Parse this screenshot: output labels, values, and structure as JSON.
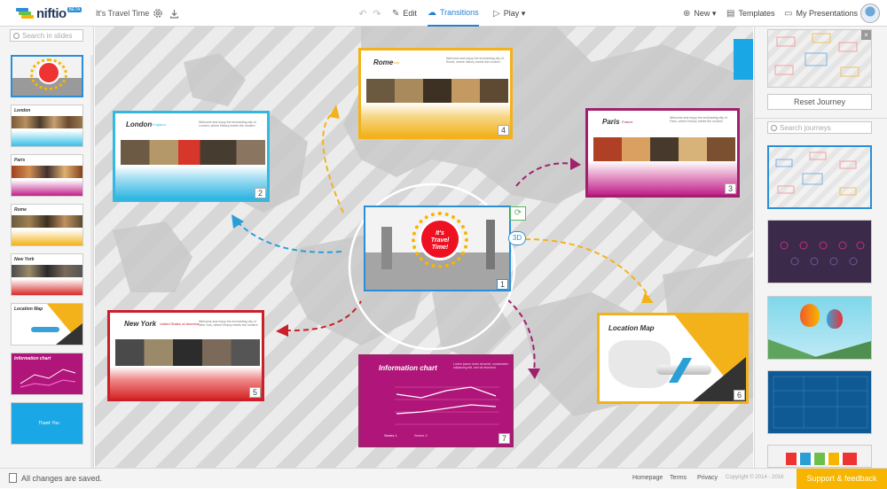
{
  "app": {
    "logo_text": "niftio",
    "logo_badge": "BETA",
    "doc_title": "It's Travel Time"
  },
  "toolbar": {
    "edit_label": "Edit",
    "transitions_label": "Transitions",
    "play_label": "Play ▾",
    "new_label": "New ▾",
    "templates_label": "Templates",
    "my_presentations_label": "My Presentations"
  },
  "left_panel": {
    "search_placeholder": "Search in slides",
    "thumbs": [
      {
        "title": "",
        "kind": "travel"
      },
      {
        "title": "London",
        "kind": "city",
        "sky": "#35c0e8"
      },
      {
        "title": "Paris",
        "kind": "city",
        "sky": "#c0208a"
      },
      {
        "title": "Rome",
        "kind": "city",
        "sky": "#f3b21a"
      },
      {
        "title": "New York",
        "kind": "city",
        "sky": "#d62828"
      },
      {
        "title": "Location Map",
        "kind": "map"
      },
      {
        "title": "Information chart",
        "kind": "chart"
      },
      {
        "title": "Thank You",
        "kind": "thanks"
      }
    ]
  },
  "canvas": {
    "slides": [
      {
        "num": "1",
        "title_lines": [
          "It's",
          "Travel",
          "Time!"
        ]
      },
      {
        "num": "2",
        "title": "London",
        "tag": "England",
        "body": "Welcome and enjoy the enchanting city of London, where history meets the modern"
      },
      {
        "num": "3",
        "title": "Paris",
        "tag": "France",
        "body": "Welcome and enjoy the enchanting city of Paris, where history meets the modern"
      },
      {
        "num": "4",
        "title": "Rome",
        "tag": "Italy",
        "body": "Welcome and enjoy the enchanting city of Rome, where history meets the modern"
      },
      {
        "num": "5",
        "title": "New York",
        "tag": "United States of America",
        "body": "Welcome and enjoy the enchanting city of New York, where history meets the modern"
      },
      {
        "num": "6",
        "title": "Location Map"
      },
      {
        "num": "7",
        "title": "Information chart",
        "body": "Lorem ipsum dolor sit amet, consectetur adipiscing elit, sed do eiusmod",
        "legend": [
          "Series 1",
          "Series 2"
        ]
      }
    ],
    "badge_3d": "3D"
  },
  "right_panel": {
    "reset_label": "Reset Journey",
    "search_placeholder": "Search journeys"
  },
  "footer": {
    "saved_text": "All changes are saved.",
    "links": [
      "Homepage",
      "Terms",
      "Privacy"
    ],
    "copyright": "Copyright © 2014 - 2016",
    "support_label": "Support & feedback"
  },
  "colors": {
    "accent": "#2a8fd6",
    "london": "#35b8e0",
    "paris": "#a0206e",
    "rome": "#f3b21a",
    "newyork": "#c9202a",
    "map": "#f3b21a",
    "chart": "#a0206e",
    "support": "#f7b500"
  }
}
